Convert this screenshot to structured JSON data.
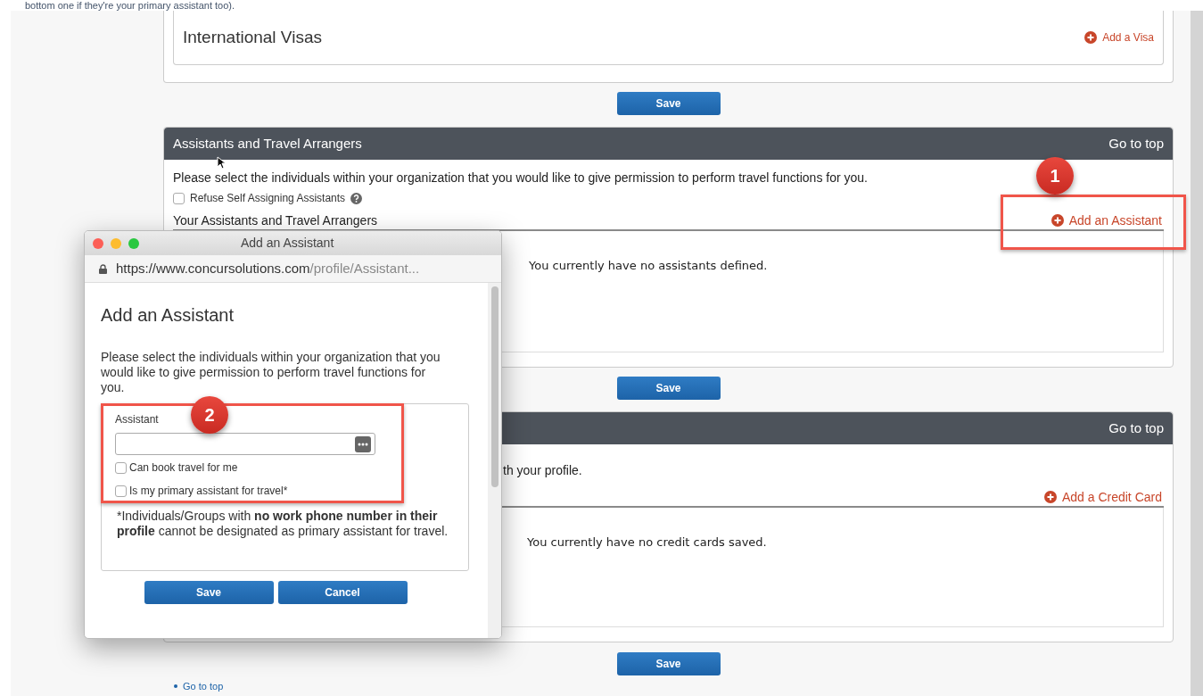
{
  "caption": "bottom one if they're your primary assistant too).",
  "visas_card": {
    "title": "International Visas",
    "add_link": "Add a Visa",
    "save_button": "Save"
  },
  "sections": [
    {
      "header_title": "Assistants and Travel Arrangers",
      "go_to_top": "Go to top",
      "description": "Please select the individuals within your organization that you would like to give permission to perform travel functions for you.",
      "checkbox": {
        "label": "Refuse Self Assigning Assistants",
        "checked": false
      },
      "list_title": "Your Assistants and Travel Arrangers",
      "add_link": "Add an Assistant",
      "empty_message": "You currently have no assistants defined.",
      "save_button": "Save"
    },
    {
      "go_to_top": "Go to top",
      "description": "th your profile.",
      "add_link": "Add a Credit Card",
      "empty_message": "You currently have no credit cards saved.",
      "save_button": "Save"
    }
  ],
  "footer_link": "Go to top",
  "callouts": [
    "1",
    "2"
  ],
  "popup": {
    "window_title": "Add an Assistant",
    "url_host": "https://www.concursolutions.com",
    "url_path": "/profile/Assistant...",
    "heading": "Add an Assistant",
    "description": "Please select the individuals within your organization that you would like to give permission to perform travel functions for you.",
    "field_label": "Assistant",
    "options": [
      {
        "label": "Can book travel for me",
        "checked": false
      },
      {
        "label": "Is my primary assistant for travel*",
        "checked": false
      }
    ],
    "note": "*Individuals/Groups with **no work phone number in their profile** cannot be designated as primary assistant for travel.",
    "buttons": [
      "Save",
      "Cancel"
    ]
  }
}
